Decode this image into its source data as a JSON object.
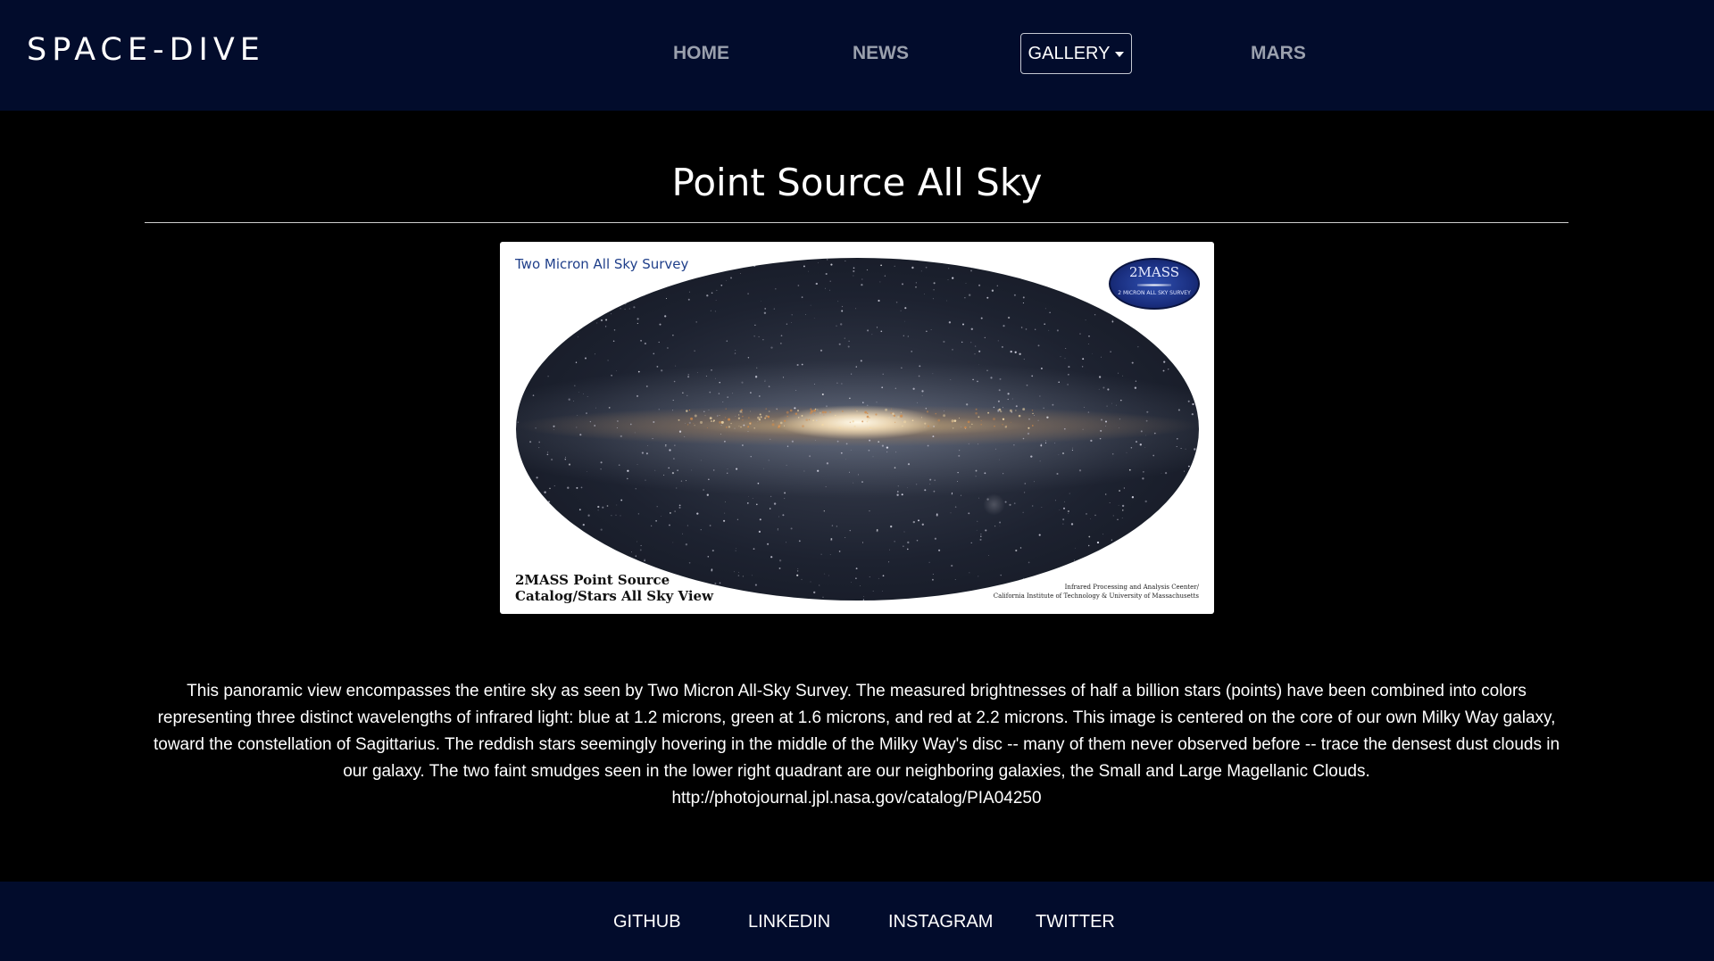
{
  "header": {
    "brand": "SPACE-DIVE",
    "nav": {
      "home": "HOME",
      "news": "NEWS",
      "gallery": "GALLERY",
      "mars": "MARS"
    }
  },
  "main": {
    "title": "Point Source All Sky",
    "image": {
      "top_caption": "Two Micron All Sky Survey",
      "bottom_caption_line1": "2MASS Point Source",
      "bottom_caption_line2": "Catalog/Stars All Sky View",
      "credit_line1": "Infrared Processing and Analysis Ceenter/",
      "credit_line2": "California Institute of Technology & University of Massachusetts",
      "logo_text": "2MASS",
      "logo_subtext": "2 MICRON ALL SKY SURVEY"
    },
    "description": "This panoramic view encompasses the entire sky as seen by Two Micron All-Sky Survey. The measured brightnesses of half a billion stars (points) have been combined into colors representing three distinct wavelengths of infrared light: blue at 1.2 microns, green at 1.6 microns, and red at 2.2 microns. This image is centered on the core of our own Milky Way galaxy, toward the constellation of Sagittarius. The reddish stars seemingly hovering in the middle of the Milky Way's disc -- many of them never observed before -- trace the densest dust clouds in our galaxy. The two faint smudges seen in the lower right quadrant are our neighboring galaxies, the Small and Large Magellanic Clouds.",
    "source_url": "http://photojournal.jpl.nasa.gov/catalog/PIA04250"
  },
  "footer": {
    "github": "GITHUB",
    "linkedin": "LINKEDIN",
    "instagram": "INSTAGRAM",
    "twitter": "TWITTER"
  },
  "colors": {
    "navbar_bg": "#020c2c",
    "page_bg": "#000000",
    "nav_link": "#9aa0ad"
  }
}
